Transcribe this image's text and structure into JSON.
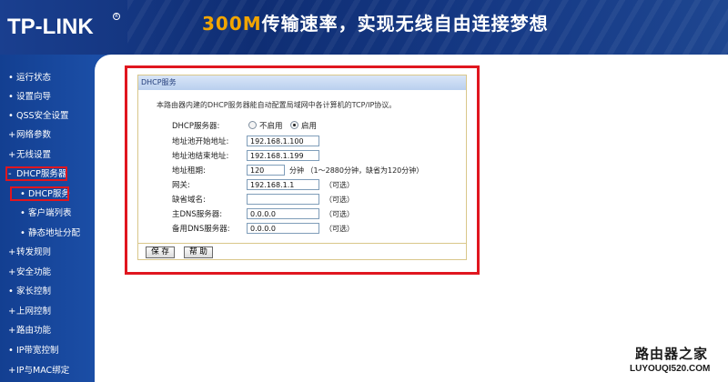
{
  "header": {
    "logo": "TP-LINK",
    "slogan_accent": "300M",
    "slogan_rest": "传输速率，实现无线自由连接梦想"
  },
  "sidebar": {
    "bullet": "•",
    "items": [
      {
        "label": "运行状态"
      },
      {
        "label": "设置向导"
      },
      {
        "label": "QSS安全设置"
      },
      {
        "label": "网络参数"
      },
      {
        "label": "无线设置"
      },
      {
        "label": "DHCP服务器"
      },
      {
        "label": "DHCP服务"
      },
      {
        "label": "客户端列表"
      },
      {
        "label": "静态地址分配"
      },
      {
        "label": "转发规则"
      },
      {
        "label": "安全功能"
      },
      {
        "label": "家长控制"
      },
      {
        "label": "上网控制"
      },
      {
        "label": "路由功能"
      },
      {
        "label": "IP带宽控制"
      },
      {
        "label": "IP与MAC绑定"
      }
    ]
  },
  "dhcp": {
    "title": "DHCP服务",
    "description": "本路由器内建的DHCP服务器能自动配置局域网中各计算机的TCP/IP协议。",
    "server_label": "DHCP服务器:",
    "disable_label": "不启用",
    "enable_label": "启用",
    "selected": "enable",
    "start_label": "地址池开始地址:",
    "start_value": "192.168.1.100",
    "end_label": "地址池结束地址:",
    "end_value": "192.168.1.199",
    "lease_label": "地址租期:",
    "lease_value": "120",
    "lease_note": "分钟  （1～2880分钟，缺省为120分钟）",
    "gateway_label": "网关:",
    "gateway_value": "192.168.1.1",
    "domain_label": "缺省域名:",
    "domain_value": "",
    "dns1_label": "主DNS服务器:",
    "dns1_value": "0.0.0.0",
    "dns2_label": "备用DNS服务器:",
    "dns2_value": "0.0.0.0",
    "optional": "（可选）",
    "save_label": "保 存",
    "help_label": "帮 助"
  },
  "watermark": {
    "line1": "路由器之家",
    "line2": "LUYOUQI520.COM"
  },
  "colors": {
    "sidebar_blue": "#1b4ea6",
    "header_blue": "#0f2e74",
    "highlight_red": "#e0161f",
    "accent_orange": "#f2a500"
  }
}
